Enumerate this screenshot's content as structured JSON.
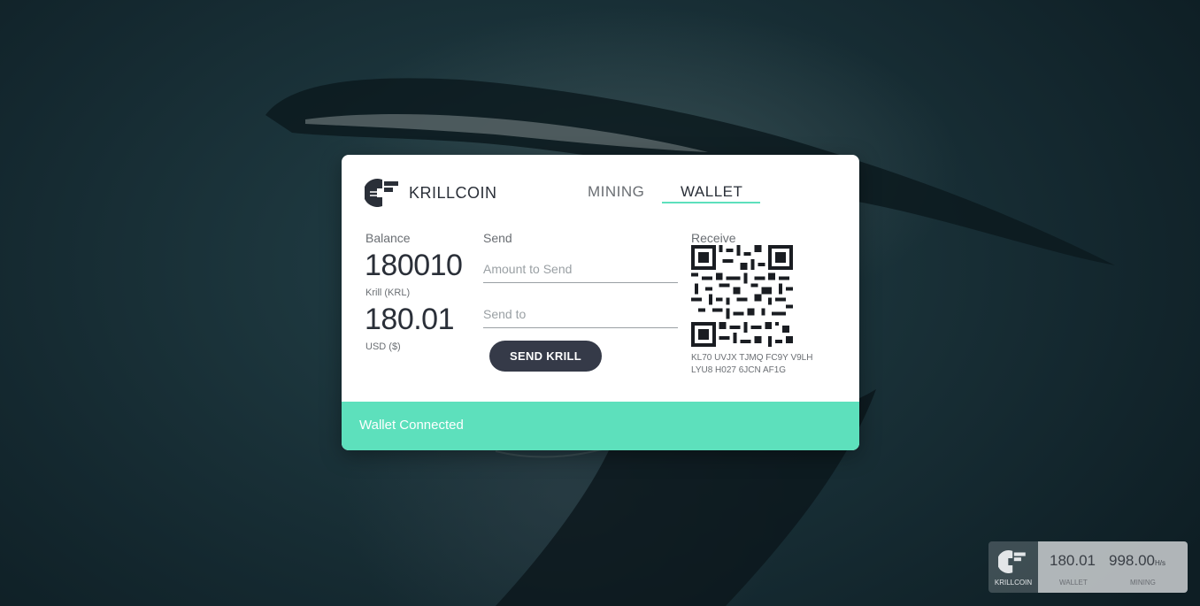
{
  "app": {
    "brand": "KRILLCOIN"
  },
  "nav": {
    "tabs": [
      {
        "label": "MINING"
      },
      {
        "label": "WALLET"
      }
    ],
    "active_tab": "WALLET"
  },
  "balance": {
    "heading": "Balance",
    "krill_amount": "180010",
    "krill_unit": "Krill (KRL)",
    "usd_amount": "180.01",
    "usd_unit": "USD ($)"
  },
  "send": {
    "heading": "Send",
    "amount_placeholder": "Amount to Send",
    "amount_value": "",
    "to_placeholder": "Send to",
    "to_value": "",
    "button_label": "SEND KRILL"
  },
  "receive": {
    "heading": "Receive",
    "address_line1": "KL70 UVJX TJMQ FC9Y V9LH",
    "address_line2": "LYU8 H027 6JCN AF1G"
  },
  "status": {
    "text": "Wallet Connected"
  },
  "widget": {
    "brand": "KRILLCOIN",
    "wallet_value": "180.01",
    "wallet_label": "WALLET",
    "mining_value": "998.00",
    "mining_unit": "H/s",
    "mining_label": "MINING"
  },
  "colors": {
    "accent": "#5de0bc",
    "button": "#353a48",
    "text_dark": "#2a2f38",
    "text_muted": "#6a6e73"
  }
}
